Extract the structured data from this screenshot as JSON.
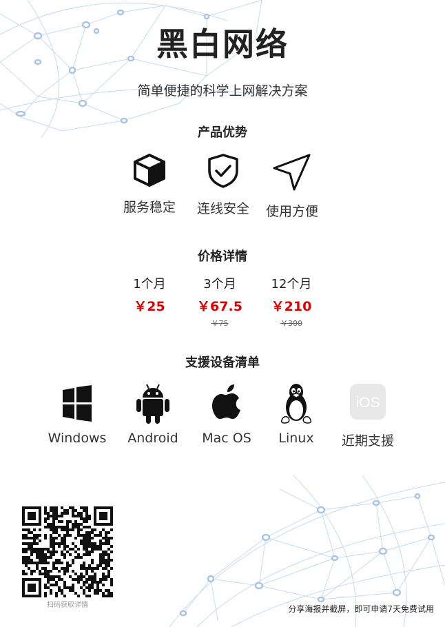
{
  "poster": {
    "title": "黑白网络",
    "subtitle": "简单便捷的科学上网解决方案"
  },
  "advantages": {
    "heading": "产品优势",
    "items": [
      {
        "label": "服务稳定",
        "icon": "cube-icon"
      },
      {
        "label": "连线安全",
        "icon": "shield-check-icon"
      },
      {
        "label": "使用方便",
        "icon": "send-arrow-icon"
      }
    ]
  },
  "pricing": {
    "heading": "价格详情",
    "plans": [
      {
        "period": "1个月",
        "price": "￥25",
        "original": ""
      },
      {
        "period": "3个月",
        "price": "￥67.5",
        "original": "￥75"
      },
      {
        "period": "12个月",
        "price": "￥210",
        "original": "￥300"
      }
    ],
    "price_color": "#e00000"
  },
  "devices": {
    "heading": "支援设备清单",
    "items": [
      {
        "label": "Windows",
        "icon": "windows-icon"
      },
      {
        "label": "Android",
        "icon": "android-icon"
      },
      {
        "label": "Mac OS",
        "icon": "apple-icon"
      },
      {
        "label": "Linux",
        "icon": "linux-tux-icon"
      },
      {
        "label": "近期支援",
        "icon": "ios-icon",
        "icon_text": "iOS"
      }
    ]
  },
  "footer": {
    "qr_caption": "扫码获取详情",
    "note": "分享海报并截屏，即可申请7天免费试用"
  }
}
